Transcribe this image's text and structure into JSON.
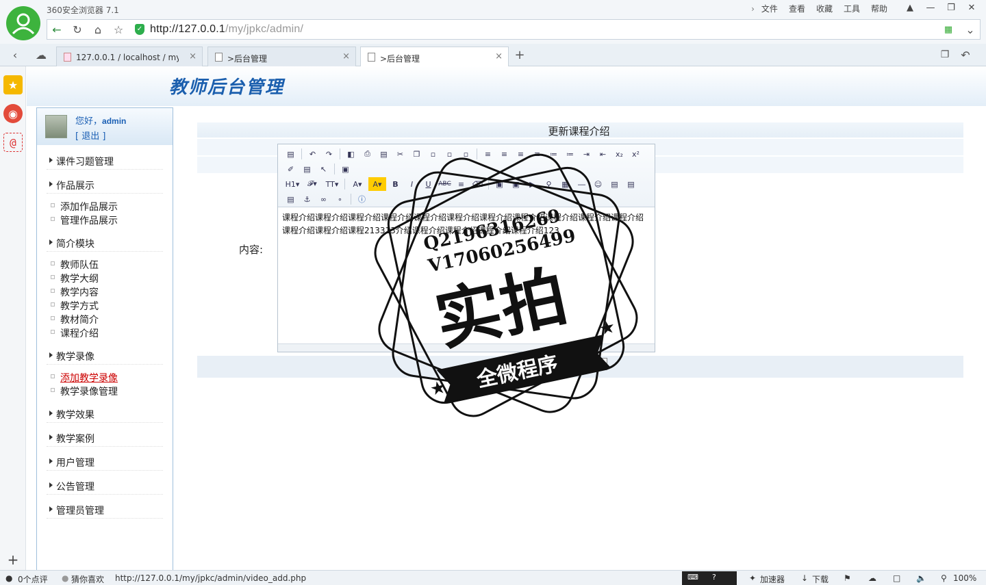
{
  "browser": {
    "app_title": "360安全浏览器 7.1",
    "menu": [
      "文件",
      "查看",
      "收藏",
      "工具",
      "帮助"
    ],
    "url_host": "http://127.0.0.1",
    "url_path": "/my/jpkc/admin/",
    "tabs": [
      {
        "label": "127.0.0.1 / localhost / my_ke"
      },
      {
        "label": ">后台管理"
      },
      {
        "label": ">后台管理"
      }
    ],
    "new_tab": "+"
  },
  "page": {
    "site_title": "教师后台管理",
    "user": {
      "greeting": "您好，",
      "name": "admin",
      "logout": "[ 退出 ]"
    },
    "nav": [
      {
        "group": "课件习题管理",
        "items": []
      },
      {
        "group": "作品展示",
        "items": [
          "添加作品展示",
          "管理作品展示"
        ]
      },
      {
        "group": "简介模块",
        "items": [
          "教师队伍",
          "教学大纲",
          "教学内容",
          "教学方式",
          "教材简介",
          "课程介绍"
        ]
      },
      {
        "group": "教学录像",
        "items": [
          "添加教学录像",
          "教学录像管理"
        ]
      },
      {
        "group": "教学效果",
        "items": []
      },
      {
        "group": "教学案例",
        "items": []
      },
      {
        "group": "用户管理",
        "items": []
      },
      {
        "group": "公告管理",
        "items": []
      },
      {
        "group": "管理员管理",
        "items": []
      }
    ],
    "form": {
      "title": "更新课程介绍",
      "content_label": "内容:",
      "editor_text": "课程介绍课程介绍课程介绍课程介绍课程介绍课程介绍课程介绍课程介绍课程介绍课程介绍课程介绍课程介绍课程介绍课程213313介绍课程介绍课程介绍课程介绍课程介绍123",
      "back_button": "返回"
    },
    "watermark": {
      "line1": "Q2196316269",
      "line2": "V17060256499",
      "big": "实拍",
      "banner": "全微程序"
    }
  },
  "statusbar": {
    "comments": "0个点评",
    "guess": "猜你喜欢",
    "link_url": "http://127.0.0.1/my/jpkc/admin/video_add.php",
    "accelerator": "加速器",
    "download": "下载",
    "zoom": "100%"
  }
}
